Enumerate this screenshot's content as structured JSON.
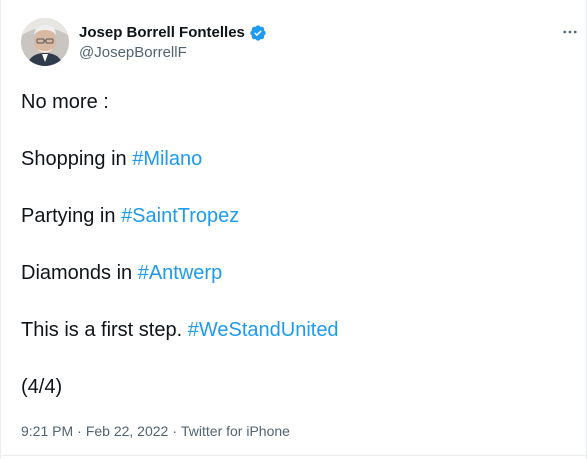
{
  "author": {
    "display_name": "Josep Borrell Fontelles",
    "handle": "@JosepBorrellF",
    "verified": true
  },
  "tweet": {
    "lines": [
      {
        "prefix": "No more :",
        "hashtag": ""
      },
      {
        "prefix": "Shopping in ",
        "hashtag": "#Milano"
      },
      {
        "prefix": "Partying in ",
        "hashtag": "#SaintTropez"
      },
      {
        "prefix": "Diamonds in ",
        "hashtag": "#Antwerp"
      },
      {
        "prefix": "This is a first step. ",
        "hashtag": "#WeStandUnited"
      },
      {
        "prefix": "(4/4)",
        "hashtag": ""
      }
    ]
  },
  "meta": {
    "time": "9:21 PM",
    "date": "Feb 22, 2022",
    "source": "Twitter for iPhone",
    "separator": "·"
  },
  "colors": {
    "hashtag": "#1d9bf0",
    "verified": "#1d9bf0",
    "text": "#0f1419",
    "secondary": "#536471"
  }
}
